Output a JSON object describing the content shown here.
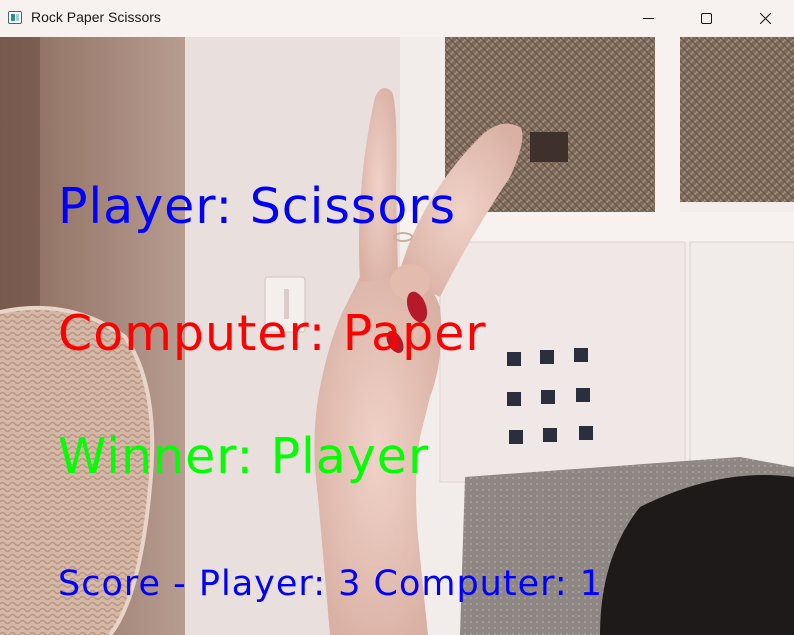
{
  "window": {
    "title": "Rock Paper Scissors",
    "controls": {
      "minimize": "minimize-icon",
      "maximize": "maximize-icon",
      "close": "close-icon"
    }
  },
  "overlay": {
    "player": "Player: Scissors",
    "computer": "Computer: Paper",
    "winner": "Winner: Player",
    "score": "Score - Player: 3 Computer: 1"
  },
  "colors": {
    "player_text": "#0000ff",
    "computer_text": "#ff0000",
    "winner_text": "#00ff00",
    "score_text": "#0000ff"
  }
}
